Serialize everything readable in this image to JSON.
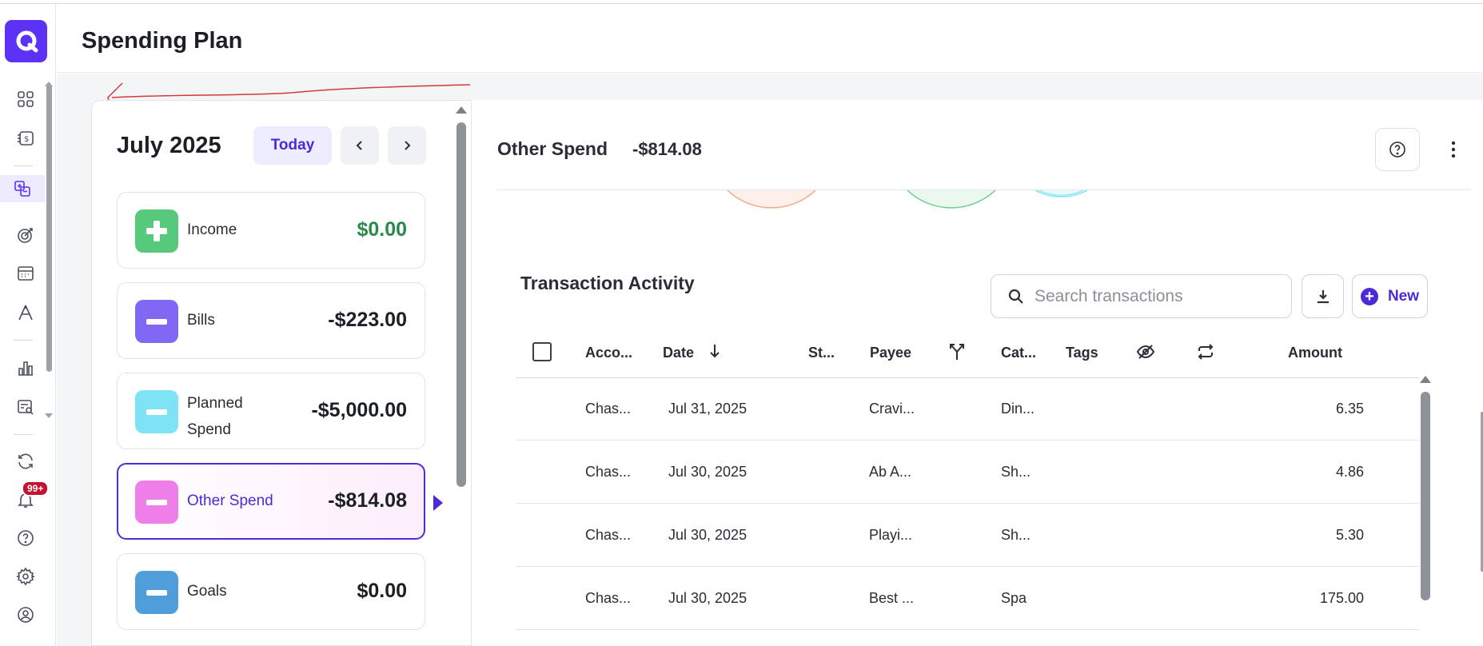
{
  "app": {
    "page_title": "Spending Plan",
    "accent_color": "#5b32f6"
  },
  "nav": {
    "icons": [
      "dashboard-icon",
      "bills-icon",
      "spending-plan-icon",
      "goals-icon",
      "calendar-icon",
      "investing-icon",
      "reports-icon",
      "search-report-icon",
      "sync-icon",
      "notifications-icon",
      "help-icon",
      "settings-icon",
      "profile-icon"
    ],
    "notification_badge": "99+"
  },
  "plan": {
    "month": "July 2025",
    "today_label": "Today",
    "prev_icon": "chevron-left-icon",
    "next_icon": "chevron-right-icon",
    "categories": [
      {
        "label": "Income",
        "amount": "$0.00",
        "color": "#57c97c",
        "icon": "plus-icon"
      },
      {
        "label": "Bills",
        "amount": "-$223.00",
        "color": "#8068f4",
        "icon": "minus-icon"
      },
      {
        "label": "Planned Spend",
        "amount": "-$5,000.00",
        "color": "#7ee3f5",
        "icon": "minus-icon"
      },
      {
        "label": "Other Spend",
        "amount": "-$814.08",
        "color": "#ef7fe8",
        "icon": "minus-icon"
      },
      {
        "label": "Goals",
        "amount": "$0.00",
        "color": "#4f9edb",
        "icon": "minus-icon"
      }
    ]
  },
  "detail": {
    "title": "Other Spend",
    "amount": "-$814.08"
  },
  "transactions": {
    "title": "Transaction Activity",
    "search_placeholder": "Search transactions",
    "new_label": "New",
    "columns": [
      "Acco...",
      "Date",
      "St...",
      "Payee",
      "Cat...",
      "Tags",
      "Amount"
    ],
    "rows": [
      {
        "account": "Chas...",
        "date": "Jul 31, 2025",
        "payee": "Cravi...",
        "category": "Din...",
        "amount": "6.35"
      },
      {
        "account": "Chas...",
        "date": "Jul 30, 2025",
        "payee": "Ab A...",
        "category": "Sh...",
        "amount": "4.86"
      },
      {
        "account": "Chas...",
        "date": "Jul 30, 2025",
        "payee": "Playi...",
        "category": "Sh...",
        "amount": "5.30"
      },
      {
        "account": "Chas...",
        "date": "Jul 30, 2025",
        "payee": "Best ...",
        "category": "Spa",
        "amount": "175.00"
      }
    ]
  }
}
